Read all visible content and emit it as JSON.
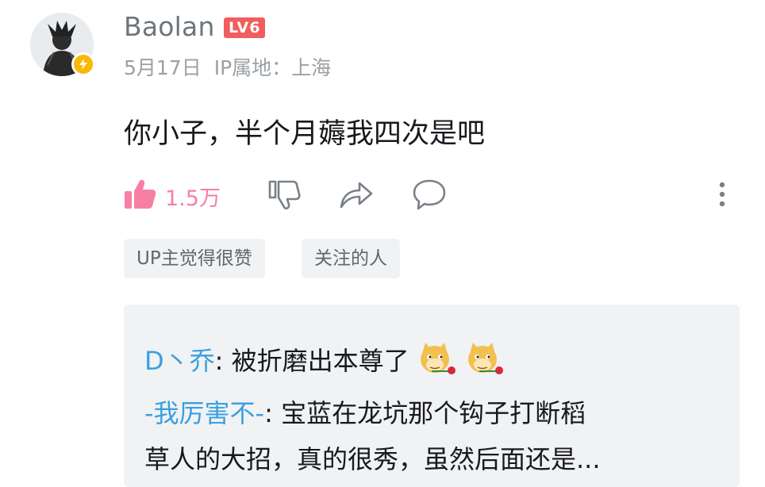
{
  "comment": {
    "user": {
      "name": "Baolan",
      "level": "LV6"
    },
    "date": "5月17日",
    "ip": "IP属地：上海",
    "text": "你小子，半个月薅我四次是吧",
    "likes": "1.5万",
    "tags": [
      "UP主觉得很赞",
      "关注的人"
    ]
  },
  "replies": [
    {
      "name": "D丶乔",
      "sep": ": ",
      "text": "被折磨出本尊了",
      "emojis": [
        "doge-rose-emoji",
        "doge-rose-emoji"
      ]
    },
    {
      "name": "-我厉害不-",
      "sep": ": ",
      "text": "宝蓝在龙坑那个钩子打断稻",
      "continuation": "草人的大招，真的很秀，虽然后面还是..."
    }
  ],
  "colors": {
    "like_pink": "#f77fa3",
    "reply_name_blue": "#3aa0e0",
    "level_badge_red": "#f25d5d",
    "verify_gold": "#fab800"
  },
  "icons": [
    "thumb-up-icon",
    "thumb-down-icon",
    "share-icon",
    "comment-icon",
    "more-icon",
    "lightning-icon"
  ]
}
